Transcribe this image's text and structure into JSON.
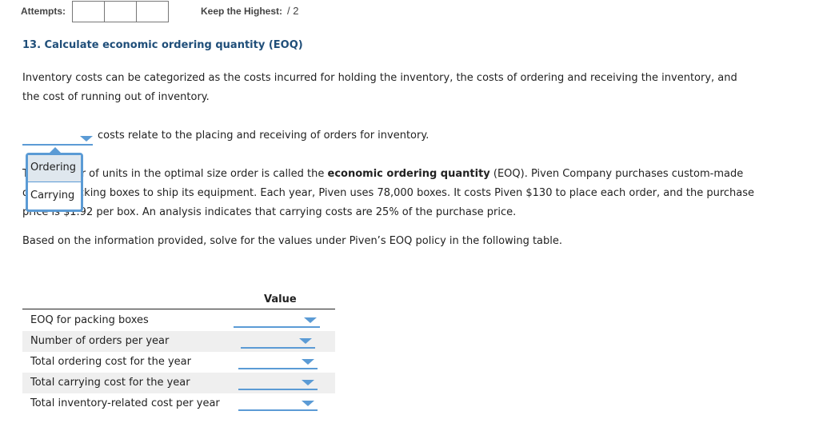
{
  "header": {
    "attempts_label": "Attempts:",
    "attempt_boxes": [
      "",
      "",
      ""
    ],
    "keep_label": "Keep the Highest:",
    "score": "/ 2"
  },
  "question": {
    "title": "13. Calculate economic ordering quantity (EOQ)",
    "intro": "Inventory costs can be categorized as the costs incurred for holding the inventory, the costs of ordering and receiving the inventory, and the cost of running out of inventory.",
    "fill_sentence": {
      "selected": "",
      "suffix": "costs relate to the placing and receiving of orders for inventory.",
      "options": [
        "Ordering",
        "Carrying"
      ],
      "highlighted_option": "Ordering"
    },
    "scenario_pre": "The number of units in the optimal size order is called the ",
    "scenario_bold": "economic ordering quantity",
    "scenario_post": " (EOQ). Piven Company purchases custom-made durable packing boxes to ship its equipment. Each year, Piven uses 78,000 boxes. It costs Piven $130 to place each order, and the purchase price is $1.92 per box. An analysis indicates that carrying costs are 25% of the purchase price.",
    "instruction": "Based on the information provided, solve for the values under Piven’s EOQ policy in the following table."
  },
  "table": {
    "column_header": "Value",
    "rows": [
      {
        "label": "EOQ for packing boxes",
        "value": ""
      },
      {
        "label": "Number of orders per year",
        "value": ""
      },
      {
        "label": "Total ordering cost for the year",
        "value": ""
      },
      {
        "label": "Total carrying cost for the year",
        "value": ""
      },
      {
        "label": "Total inventory-related cost per year",
        "value": ""
      }
    ]
  },
  "colors": {
    "accent": "#5b9bd5",
    "title": "#1f4e79",
    "row_shade": "#efefef"
  }
}
